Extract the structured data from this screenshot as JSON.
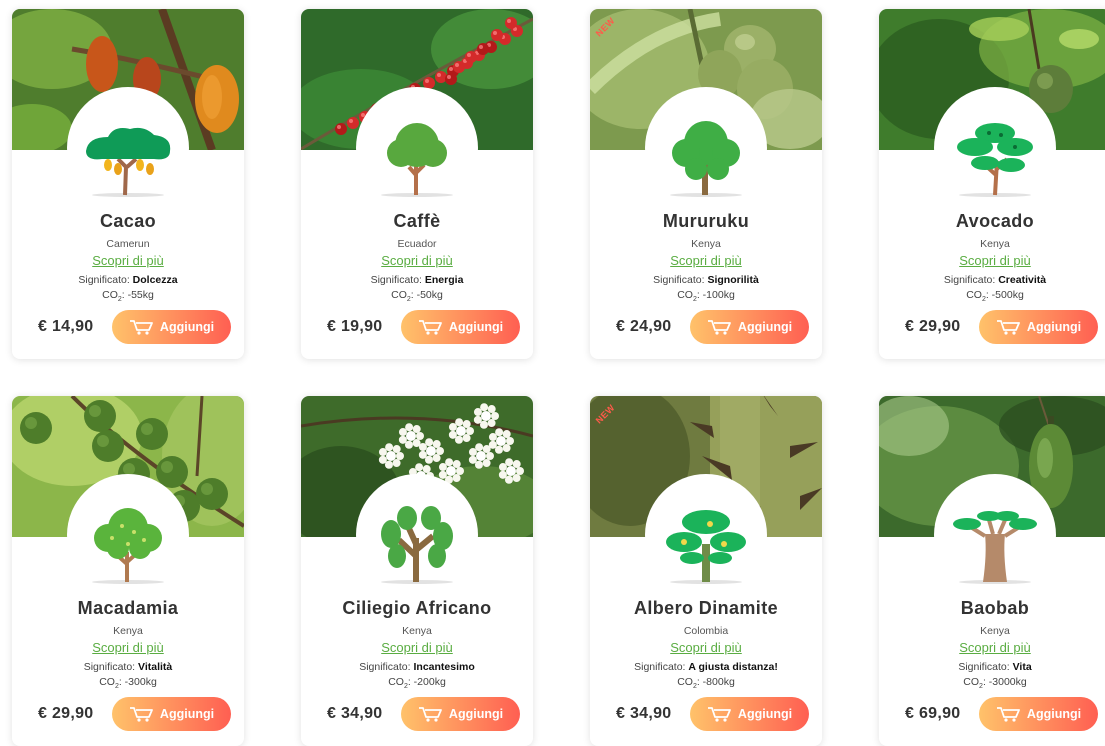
{
  "products": [
    {
      "name": "Cacao",
      "country": "Camerun",
      "more": "Scopri di più",
      "meaning_label": "Significato:",
      "meaning": "Dolcezza",
      "co2_prefix": "CO",
      "co2_sub": "2",
      "co2_value": ": -55kg",
      "price": "€ 14,90",
      "button": "Aggiungi",
      "new": false,
      "tree": "cacao",
      "photo": "cacao"
    },
    {
      "name": "Caffè",
      "country": "Ecuador",
      "more": "Scopri di più",
      "meaning_label": "Significato:",
      "meaning": "Energia",
      "co2_prefix": "CO",
      "co2_sub": "2",
      "co2_value": ": -50kg",
      "price": "€ 19,90",
      "button": "Aggiungi",
      "new": false,
      "tree": "caffe",
      "photo": "coffee"
    },
    {
      "name": "Mururuku",
      "country": "Kenya",
      "more": "Scopri di più",
      "meaning_label": "Significato:",
      "meaning": "Signorilità",
      "co2_prefix": "CO",
      "co2_sub": "2",
      "co2_value": ": -100kg",
      "price": "€ 24,90",
      "button": "Aggiungi",
      "new": true,
      "new_label": "NEW",
      "tree": "mururuku",
      "photo": "mururuku"
    },
    {
      "name": "Avocado",
      "country": "Kenya",
      "more": "Scopri di più",
      "meaning_label": "Significato:",
      "meaning": "Creatività",
      "co2_prefix": "CO",
      "co2_sub": "2",
      "co2_value": ": -500kg",
      "price": "€ 29,90",
      "button": "Aggiungi",
      "new": false,
      "tree": "avocado",
      "photo": "avocado"
    },
    {
      "name": "Macadamia",
      "country": "Kenya",
      "more": "Scopri di più",
      "meaning_label": "Significato:",
      "meaning": "Vitalità",
      "co2_prefix": "CO",
      "co2_sub": "2",
      "co2_value": ": -300kg",
      "price": "€ 29,90",
      "button": "Aggiungi",
      "new": false,
      "tree": "macadamia",
      "photo": "macadamia"
    },
    {
      "name": "Ciliegio Africano",
      "country": "Kenya",
      "more": "Scopri di più",
      "meaning_label": "Significato:",
      "meaning": "Incantesimo",
      "co2_prefix": "CO",
      "co2_sub": "2",
      "co2_value": ": -200kg",
      "price": "€ 34,90",
      "button": "Aggiungi",
      "new": false,
      "tree": "ciliegio",
      "photo": "blossom"
    },
    {
      "name": "Albero Dinamite",
      "country": "Colombia",
      "more": "Scopri di più",
      "meaning_label": "Significato:",
      "meaning": "A giusta distanza!",
      "co2_prefix": "CO",
      "co2_sub": "2",
      "co2_value": ": -800kg",
      "price": "€ 34,90",
      "button": "Aggiungi",
      "new": true,
      "new_label": "NEW",
      "tree": "dinamite",
      "photo": "dinamite"
    },
    {
      "name": "Baobab",
      "country": "Kenya",
      "more": "Scopri di più",
      "meaning_label": "Significato:",
      "meaning": "Vita",
      "co2_prefix": "CO",
      "co2_sub": "2",
      "co2_value": ": -3000kg",
      "price": "€ 69,90",
      "button": "Aggiungi",
      "new": false,
      "tree": "baobab",
      "photo": "baobab"
    }
  ],
  "colors": {
    "link": "#5aad42",
    "button_start": "#ffc26a",
    "button_end": "#ff5f52",
    "new_badge": "#ff5a4a"
  }
}
